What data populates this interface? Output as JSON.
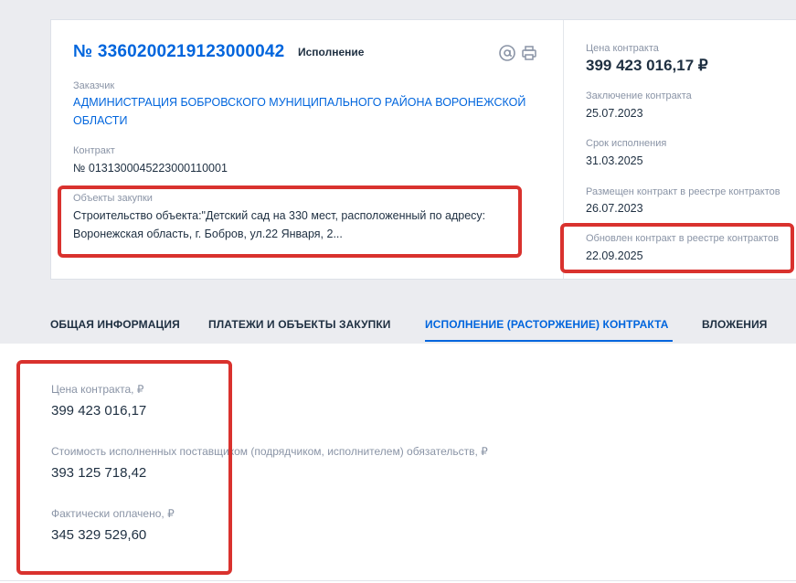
{
  "header": {
    "reg_number": "№ 3360200219123000042",
    "status": "Исполнение"
  },
  "icons": [
    "email-icon",
    "print-icon"
  ],
  "customer": {
    "label": "Заказчик",
    "line1": "АДМИНИСТРАЦИЯ БОБРОВСКОГО МУНИЦИПАЛЬНОГО РАЙОНА ВОРОНЕЖСКОЙ",
    "line2": "ОБЛАСТИ"
  },
  "contract": {
    "label": "Контракт",
    "value": "№ 0131300045223000110001"
  },
  "objects": {
    "label": "Объекты закупки",
    "line1": "Строительство объекта:\"Детский сад на 330 мест, расположенный по адресу:",
    "line2": "Воронежская область, г. Бобров, ул.22 Января, 2..."
  },
  "summary": {
    "price_label": "Цена контракта",
    "price_value": "399 423 016,17 ₽",
    "conclusion_label": "Заключение контракта",
    "conclusion_value": "25.07.2023",
    "term_label": "Срок исполнения",
    "term_value": "31.03.2025",
    "posted_label": "Размещен контракт в реестре контрактов",
    "posted_value": "26.07.2023",
    "updated_label": "Обновлен контракт в реестре контрактов",
    "updated_value": "22.09.2025"
  },
  "tabs": [
    {
      "label": "ОБЩАЯ ИНФОРМАЦИЯ"
    },
    {
      "label": "ПЛАТЕЖИ И ОБЪЕКТЫ ЗАКУПКИ"
    },
    {
      "label": "ИСПОЛНЕНИЕ (РАСТОРЖЕНИЕ) КОНТРАКТА"
    },
    {
      "label": "ВЛОЖЕНИЯ"
    }
  ],
  "execution": {
    "price_label": "Цена контракта, ₽",
    "price_value": "399 423 016,17",
    "fulfilled_label": "Стоимость исполненных поставщиком (подрядчиком, исполнителем) обязательств, ₽",
    "fulfilled_value": "393 125 718,42",
    "paid_label": "Фактически оплачено, ₽",
    "paid_value": "345 329 529,60"
  },
  "colors": {
    "accent": "#0065dd",
    "highlight": "#d9322e",
    "background": "#ebecf0"
  }
}
